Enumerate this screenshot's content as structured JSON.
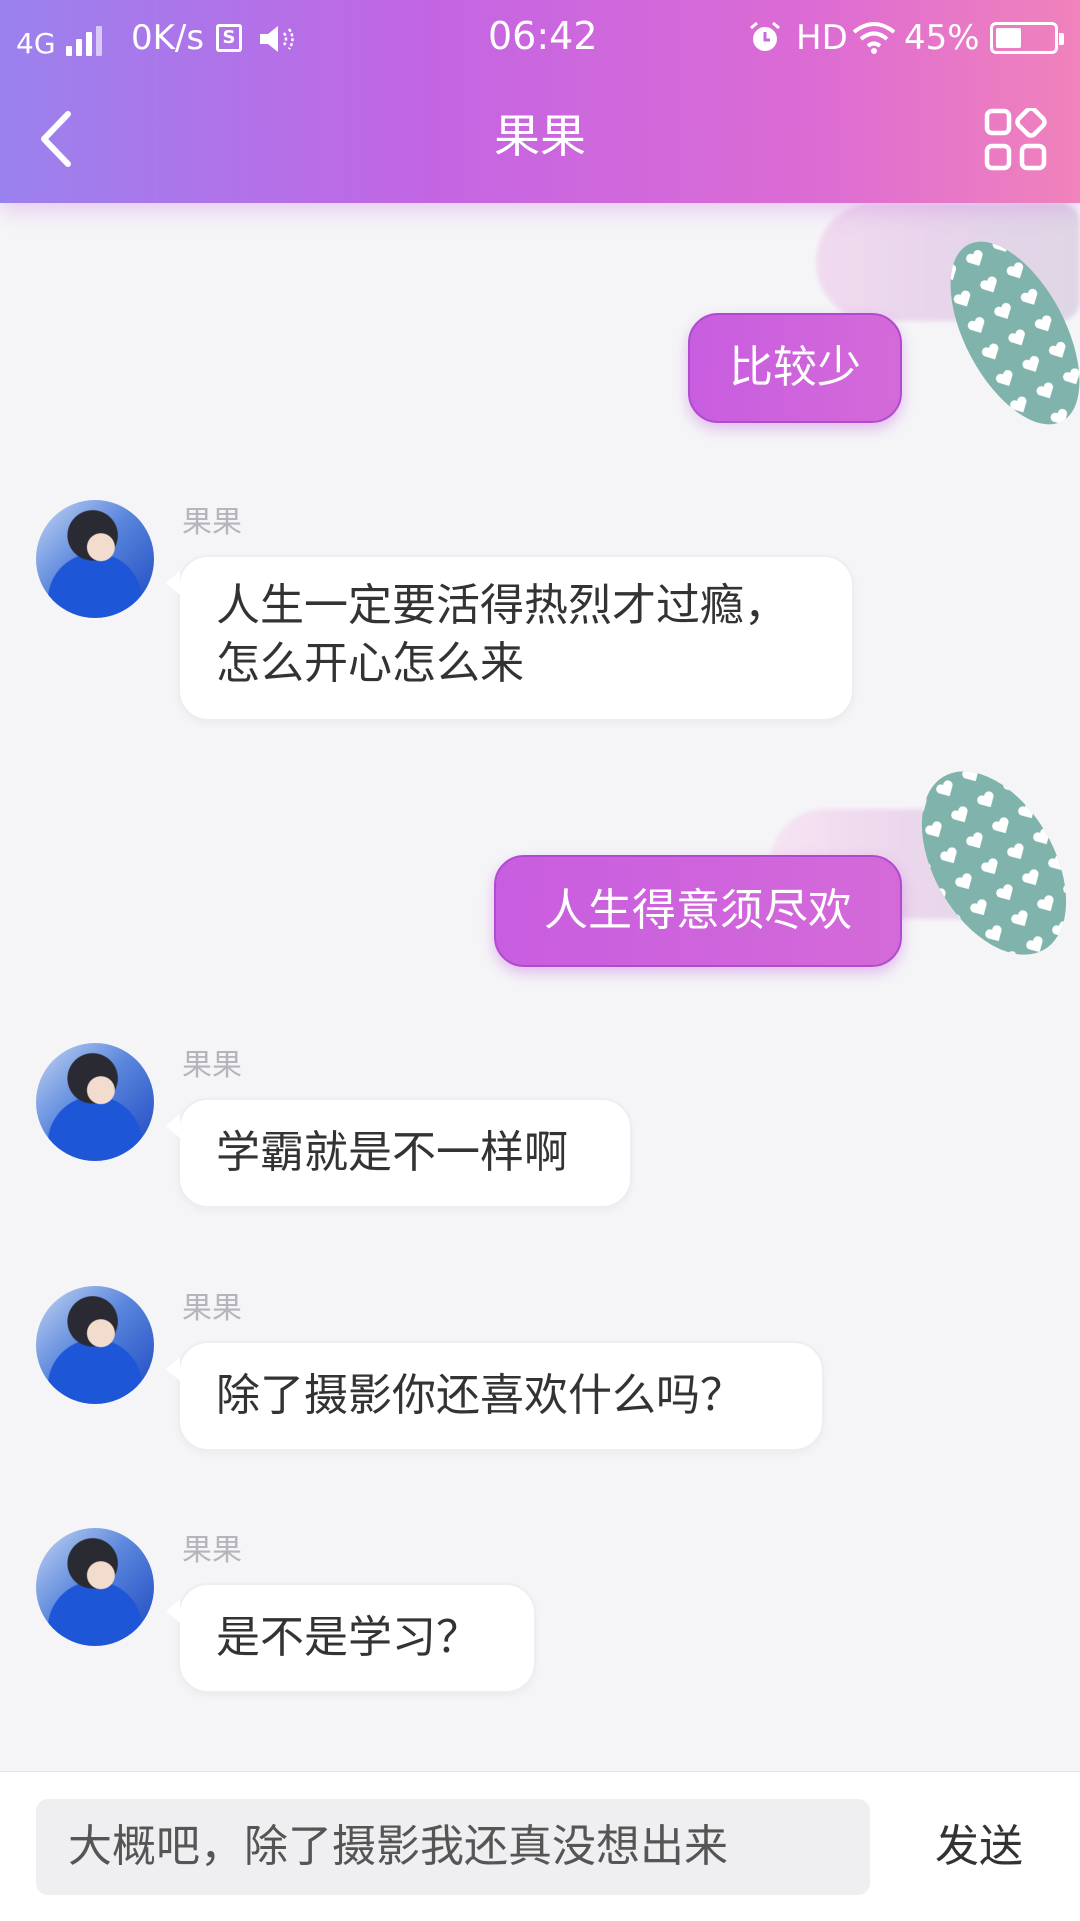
{
  "status_bar": {
    "network": "4G",
    "speed": "0K/s",
    "time": "06:42",
    "hd": "HD",
    "battery": "45%",
    "battery_level": 0.45
  },
  "header": {
    "title": "果果"
  },
  "messages": [
    {
      "id": "m1",
      "direction": "out",
      "text": "比较少"
    },
    {
      "id": "m2",
      "direction": "in",
      "sender": "果果",
      "text": "人生一定要活得热烈才过瘾，怎么开心怎么来"
    },
    {
      "id": "m3",
      "direction": "out",
      "text": "人生得意须尽欢"
    },
    {
      "id": "m4",
      "direction": "in",
      "sender": "果果",
      "text": "学霸就是不一样啊"
    },
    {
      "id": "m5",
      "direction": "in",
      "sender": "果果",
      "text": "除了摄影你还喜欢什么吗？"
    },
    {
      "id": "m6",
      "direction": "in",
      "sender": "果果",
      "text": "是不是学习？"
    }
  ],
  "input": {
    "value": "大概吧，除了摄影我还真没想出来"
  },
  "send_label": "发送",
  "colors": {
    "header_gradient_start": "#9a82ee",
    "header_gradient_end": "#f182bb",
    "out_bubble": "#c85de0",
    "sticker": "#7fb3ab"
  },
  "icons": [
    "back-arrow-icon",
    "grid-menu-icon",
    "alarm-icon",
    "wifi-icon",
    "battery-icon",
    "speaker-icon",
    "sim-icon",
    "heart-sticker-icon"
  ]
}
